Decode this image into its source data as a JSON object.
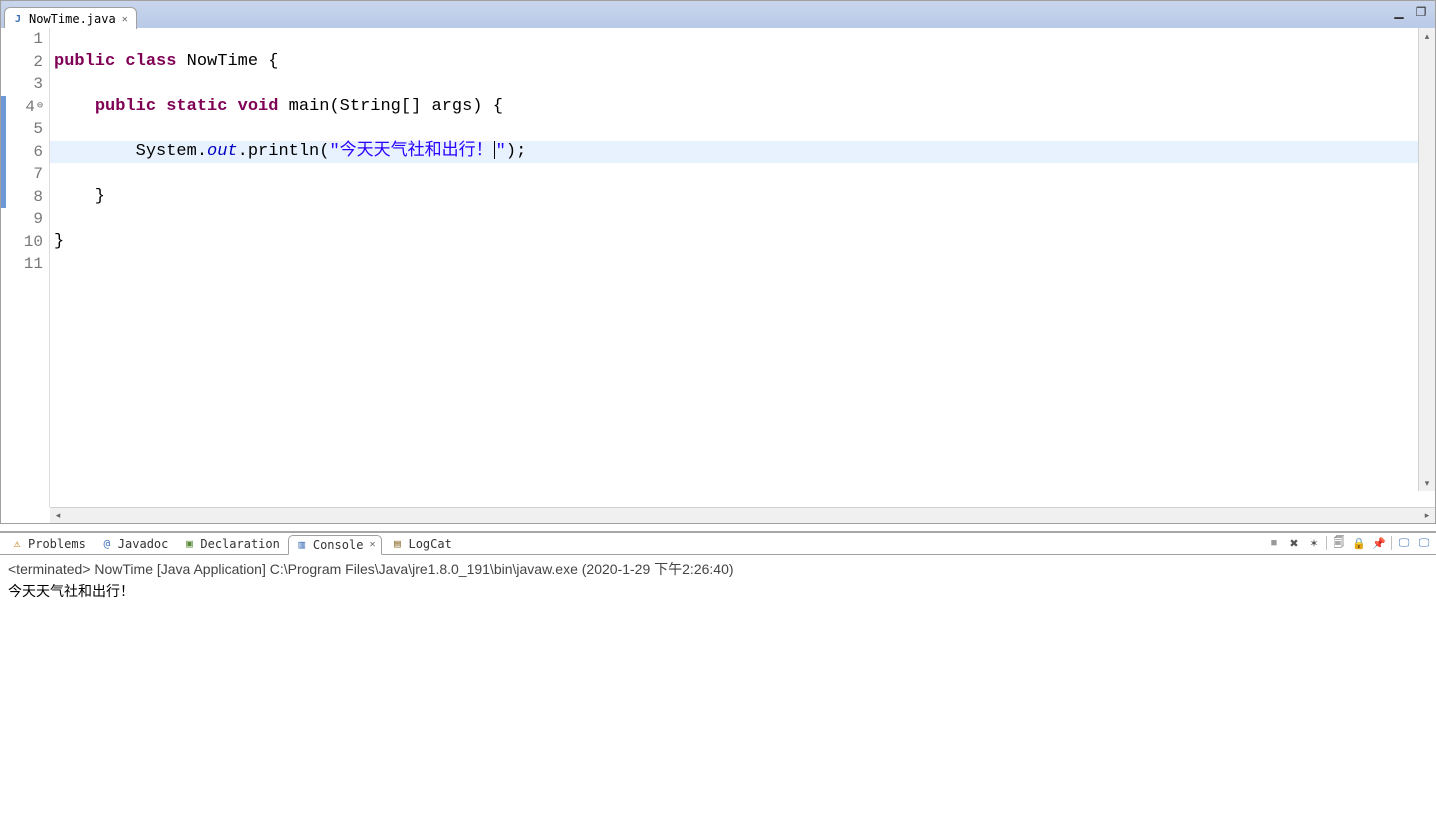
{
  "editor": {
    "tab": {
      "filename": "NowTime.java",
      "close_glyph": "✕"
    },
    "minimize_glyph": "▁",
    "maximize_glyph": "❐",
    "lines": [
      "1",
      "2",
      "3",
      "4",
      "5",
      "6",
      "7",
      "8",
      "9",
      "10",
      "11"
    ],
    "code": {
      "l2": {
        "pre": "",
        "k1": "public",
        "s1": " ",
        "k2": "class",
        "s2": " NowTime {"
      },
      "l4": {
        "indent": "    ",
        "k1": "public",
        "s1": " ",
        "k2": "static",
        "s2": " ",
        "k3": "void",
        "rest": " main(String[] args) {"
      },
      "l6": {
        "indent": "        System.",
        "field": "out",
        "mid": ".println(",
        "str_open": "\"",
        "str_body": "今天天气社和出行！",
        "str_close": "\"",
        "tail": ");"
      },
      "l8": {
        "text": "    }"
      },
      "l10": {
        "text": "}"
      }
    },
    "fold_glyph": "⊖"
  },
  "views": {
    "problems": {
      "label": "Problems"
    },
    "javadoc": {
      "label": "Javadoc"
    },
    "declaration": {
      "label": "Declaration"
    },
    "console": {
      "label": "Console",
      "close_glyph": "✕"
    },
    "logcat": {
      "label": "LogCat"
    }
  },
  "console": {
    "status": "<terminated> NowTime [Java Application] C:\\Program Files\\Java\\jre1.8.0_191\\bin\\javaw.exe (2020-1-29 下午2:26:40)",
    "output": "今天天气社和出行！"
  },
  "toolbar_glyphs": {
    "terminate": "■",
    "remove": "✖",
    "remove_all": "✶",
    "clear": "🗐",
    "lock": "🔒",
    "pin": "📌",
    "display": "🖵",
    "open": "🖵"
  }
}
